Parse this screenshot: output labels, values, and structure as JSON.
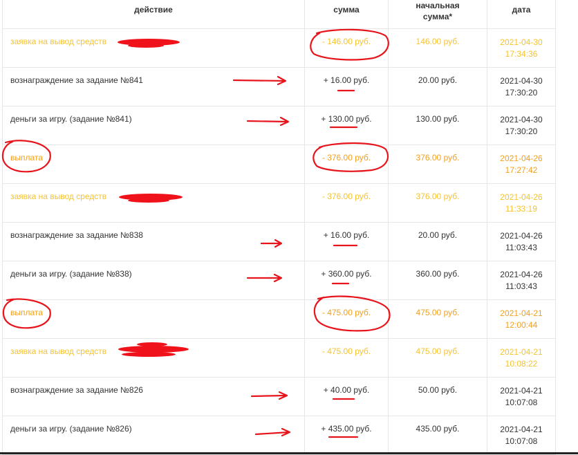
{
  "header": {
    "action": "действие",
    "sum": "сумма",
    "initial_line1": "начальная",
    "initial_line2": "сумма*",
    "date": "дата"
  },
  "rows": [
    {
      "action": "заявка на вывод средств",
      "sign": "-",
      "amount": "146.00",
      "currency": "руб.",
      "initial": "146.00 руб.",
      "date": "2021-04-30",
      "time": "17:34:36",
      "kind": "request"
    },
    {
      "action": "вознаграждение за задание №841",
      "sign": "+",
      "amount": "16.00",
      "currency": "руб.",
      "initial": "20.00 руб.",
      "date": "2021-04-30",
      "time": "17:30:20",
      "kind": "normal"
    },
    {
      "action": "деньги за игру. (задание №841)",
      "sign": "+",
      "amount": "130.00",
      "currency": "руб.",
      "initial": "130.00 руб.",
      "date": "2021-04-30",
      "time": "17:30:20",
      "kind": "normal"
    },
    {
      "action": "выплата",
      "sign": "-",
      "amount": "376.00",
      "currency": "руб.",
      "initial": "376.00 руб.",
      "date": "2021-04-26",
      "time": "17:27:42",
      "kind": "payout"
    },
    {
      "action": "заявка на вывод средств",
      "sign": "-",
      "amount": "376.00",
      "currency": "руб.",
      "initial": "376.00 руб.",
      "date": "2021-04-26",
      "time": "11:33:19",
      "kind": "request"
    },
    {
      "action": "вознаграждение за задание №838",
      "sign": "+",
      "amount": "16.00",
      "currency": "руб.",
      "initial": "20.00 руб.",
      "date": "2021-04-26",
      "time": "11:03:43",
      "kind": "normal"
    },
    {
      "action": "деньги за игру. (задание №838)",
      "sign": "+",
      "amount": "360.00",
      "currency": "руб.",
      "initial": "360.00 руб.",
      "date": "2021-04-26",
      "time": "11:03:43",
      "kind": "normal"
    },
    {
      "action": "выплата",
      "sign": "-",
      "amount": "475.00",
      "currency": "руб.",
      "initial": "475.00 руб.",
      "date": "2021-04-21",
      "time": "12:00:44",
      "kind": "payout"
    },
    {
      "action": "заявка на вывод средств",
      "sign": "-",
      "amount": "475.00",
      "currency": "руб.",
      "initial": "475.00 руб.",
      "date": "2021-04-21",
      "time": "10:08:22",
      "kind": "request"
    },
    {
      "action": "вознаграждение за задание №826",
      "sign": "+",
      "amount": "40.00",
      "currency": "руб.",
      "initial": "50.00 руб.",
      "date": "2021-04-21",
      "time": "10:07:08",
      "kind": "normal"
    },
    {
      "action": "деньги за игру. (задание №826)",
      "sign": "+",
      "amount": "435.00",
      "currency": "руб.",
      "initial": "435.00 руб.",
      "date": "2021-04-21",
      "time": "10:07:08",
      "kind": "normal"
    }
  ],
  "colors": {
    "request": "#f5c330",
    "payout": "#f0a020",
    "normal": "#333333",
    "annotation": "#e8141c"
  },
  "annotations": {
    "icon": "hand-drawn-red-markup"
  }
}
